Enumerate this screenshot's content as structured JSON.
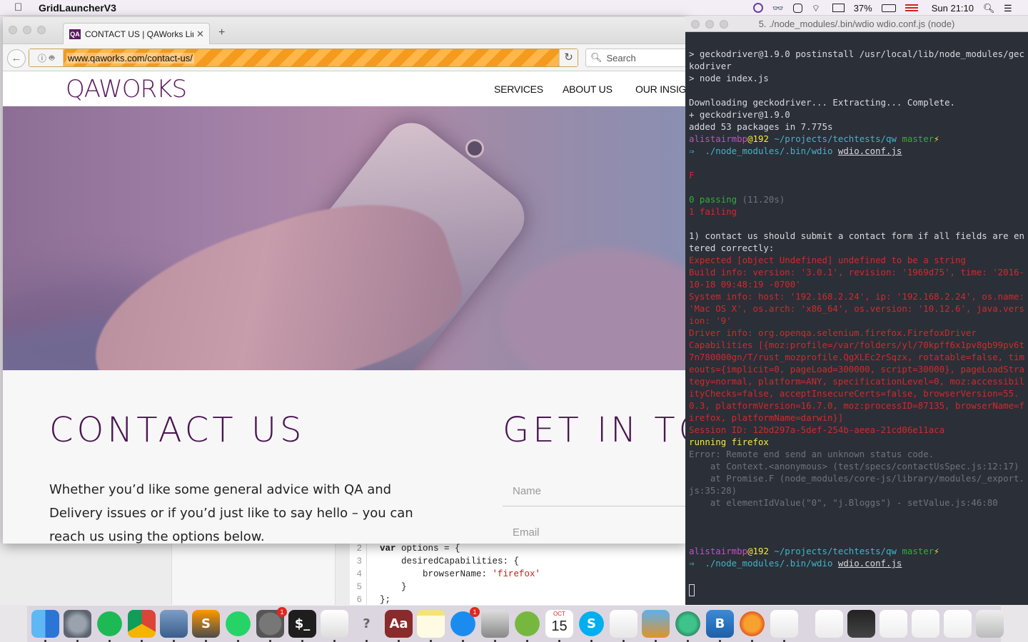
{
  "menubar": {
    "app_name": "GridLauncherV3",
    "battery": "37%",
    "clock": "Sun 21:10"
  },
  "browser": {
    "tab_title": "CONTACT US | QAWorks Limited",
    "favicon_text": "QA",
    "url": "www.qaworks.com/contact-us/",
    "search_placeholder": "Search"
  },
  "site": {
    "logo": "QAWORKS",
    "nav": [
      "SERVICES",
      "ABOUT US",
      "OUR INSIGHTS"
    ],
    "contact_heading": "CONTACT US",
    "get_heading": "GET IN TOUCH",
    "intro": "Whether you’d like some general advice with QA and Delivery issues or if you’d just like to say hello – you can reach us using the options below.",
    "name_placeholder": "Name",
    "email_placeholder": "Email"
  },
  "editor": {
    "line_numbers": [
      "2",
      "3",
      "4",
      "5",
      "6"
    ],
    "lines": [
      {
        "kw": "var",
        "rest": " options = {"
      },
      {
        "kw": "",
        "rest": "    desiredCapabilities: {"
      },
      {
        "kw": "",
        "rest": "        browserName: ",
        "str": "'firefox'"
      },
      {
        "kw": "",
        "rest": "    }"
      },
      {
        "kw": "",
        "rest": "};"
      }
    ]
  },
  "terminal": {
    "title": "5. ./node_modules/.bin/wdio wdio.conf.js (node)",
    "lines": [
      {
        "t": "> geckodriver@1.9.0 postinstall /usr/local/lib/node_modules/geckodriver",
        "c": ""
      },
      {
        "t": "> node index.js",
        "c": ""
      },
      {
        "t": "",
        "c": ""
      },
      {
        "t": "Downloading geckodriver... Extracting... Complete.",
        "c": ""
      },
      {
        "t": "+ geckodriver@1.9.0",
        "c": ""
      },
      {
        "t": "added 53 packages in 7.775s",
        "c": ""
      },
      {
        "t": "PROMPT1",
        "c": "prompt"
      },
      {
        "t": "⇒  ./node_modules/.bin/wdio wdio.conf.js",
        "c": "cmd"
      },
      {
        "t": "",
        "c": ""
      },
      {
        "t": "F",
        "c": "red"
      },
      {
        "t": "",
        "c": ""
      },
      {
        "t": "0 passing (11.20s)",
        "c": "passing"
      },
      {
        "t": "1 failing",
        "c": "red"
      },
      {
        "t": "",
        "c": ""
      },
      {
        "t": "1) contact us should submit a contact form if all fields are entered correctly:",
        "c": ""
      },
      {
        "t": "Expected [object Undefined] undefined to be a string",
        "c": "red"
      },
      {
        "t": "Build info: version: '3.0.1', revision: '1969d75', time: '2016-10-18 09:48:19 -0700'",
        "c": "red"
      },
      {
        "t": "System info: host: '192.168.2.24', ip: '192.168.2.24', os.name: 'Mac OS X', os.arch: 'x86_64', os.version: '10.12.6', java.version: '9'",
        "c": "red"
      },
      {
        "t": "Driver info: org.openqa.selenium.firefox.FirefoxDriver",
        "c": "red"
      },
      {
        "t": "Capabilities [{moz:profile=/var/folders/yl/70kpff6x1pv8gb99pv6t7n780000gn/T/rust_mozprofile.QgXLEc2rSqzx, rotatable=false, timeouts={implicit=0, pageLoad=300000, script=30000}, pageLoadStrategy=normal, platform=ANY, specificationLevel=0, moz:accessibilityChecks=false, acceptInsecureCerts=false, browserVersion=55.0.3, platformVersion=16.7.0, moz:processID=87135, browserName=firefox, platformName=darwin}]",
        "c": "red"
      },
      {
        "t": "Session ID: 12bd297a-5def-254b-aeea-21cd06e11aca",
        "c": "red"
      },
      {
        "t": "running firefox",
        "c": "yel"
      },
      {
        "t": "Error: Remote end send an unknown status code.",
        "c": "gry"
      },
      {
        "t": "    at Context.<anonymous> (test/specs/contactUsSpec.js:12:17)",
        "c": "gry"
      },
      {
        "t": "    at Promise.F (node_modules/core-js/library/modules/_export.js:35:28)",
        "c": "gry"
      },
      {
        "t": "    at elementIdValue(\"0\", \"j.Bloggs\") - setValue.js:46:80",
        "c": "gry"
      },
      {
        "t": "",
        "c": ""
      },
      {
        "t": "",
        "c": ""
      },
      {
        "t": "",
        "c": ""
      },
      {
        "t": "PROMPT2",
        "c": "prompt"
      },
      {
        "t": "⇒  ./node_modules/.bin/wdio wdio.conf.js",
        "c": "cmd"
      },
      {
        "t": "",
        "c": ""
      },
      {
        "t": "CURSOR",
        "c": "cursor"
      }
    ],
    "prompt": {
      "user": "alistairmbp",
      "host": "@192",
      "path": " ~/projects/techtests/qw",
      "branch": " master",
      "bolt": "⚡"
    }
  },
  "dock": {
    "items": [
      "finder-icon",
      "launchpad-icon",
      "spotify-icon",
      "chrome-icon",
      "preview-icon",
      "sublime-icon",
      "whatsapp-icon",
      "system-preferences-icon",
      "terminal-icon",
      "textedit-icon",
      "help-icon",
      "dictionary-icon",
      "notes-icon",
      "app-store-icon",
      "xcode-tools-icon",
      "utorrent-icon",
      "calendar-icon",
      "skype-icon",
      "activity-monitor-icon",
      "keynote-icon",
      "atom-icon",
      "bbedit-icon",
      "firefox-icon",
      "java-icon",
      "docx-file-icon",
      "stack-file-icon",
      "document-icon",
      "document2-icon",
      "document3-icon",
      "trash-icon"
    ],
    "calendar_month": "OCT",
    "calendar_day": "15",
    "sysprefs_badge": "1",
    "appstore_badge": "1"
  }
}
